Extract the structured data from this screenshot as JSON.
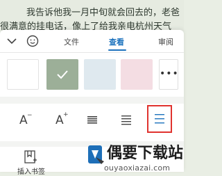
{
  "document": {
    "line1": "我告诉他我一月中旬就会回去的，老爸",
    "line2": "很满意的挂电话，像上了给我亲电杭州天气"
  },
  "toolbar_tabs": {
    "file": "文件",
    "view": "查看",
    "review": "审阅"
  },
  "background_swatches": {
    "colors": [
      "#ffffff",
      "#9caf98",
      "#dfe9ef",
      "#f4dde3",
      "#ffffff"
    ],
    "selected": 1,
    "more_label": "•••"
  },
  "text_controls": {
    "decrease_font_glyph": "A",
    "decrease_font_mark": "−",
    "increase_font_glyph": "A",
    "increase_font_mark": "+"
  },
  "bottom_bar": {
    "bookmark_label": "插入书签"
  },
  "watermark": {
    "title": "偶要下载站",
    "url": "ouyaoxiazai.com"
  },
  "colors": {
    "accent": "#1e73be",
    "highlight_border": "#e0332e"
  }
}
